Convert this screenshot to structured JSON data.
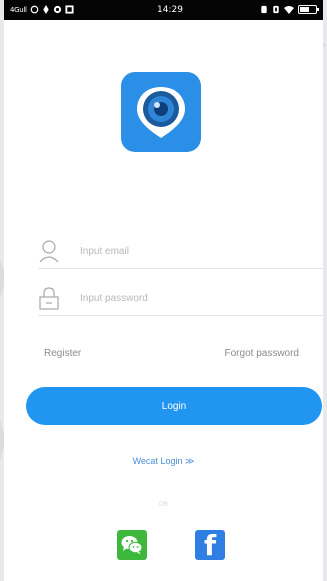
{
  "status_bar": {
    "carrier": "4Gull",
    "left_icons": [
      "alarm-icon",
      "location-icon",
      "sync-icon",
      "image-icon"
    ],
    "time": "14:29",
    "right_icons": [
      "alarm-clock-icon",
      "vibrate-icon",
      "wifi-icon",
      "battery-icon"
    ]
  },
  "app": {
    "logo_icon": "camera-pin-logo",
    "brand_color": "#2196f0"
  },
  "login_form": {
    "email_placeholder": "Input email",
    "email_value": "",
    "password_placeholder": "Input password",
    "password_value": "",
    "register_label": "Register",
    "forgot_label": "Forgot password",
    "login_label": "Login"
  },
  "alt_login": {
    "wechat_login_label": "Wecat Login ≫",
    "or_label": "OR",
    "social": [
      "wechat-icon",
      "facebook-icon"
    ],
    "wechat_color": "#3db83d",
    "facebook_color": "#2f7ee3"
  }
}
